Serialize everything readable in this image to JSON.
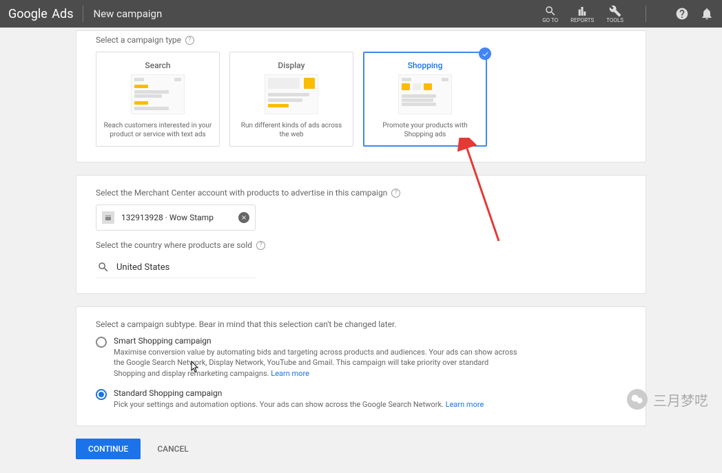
{
  "header": {
    "logo_prefix": "Google",
    "logo_suffix": "Ads",
    "page_title": "New campaign",
    "tools": [
      {
        "label": "GO TO"
      },
      {
        "label": "REPORTS"
      },
      {
        "label": "TOOLS"
      }
    ]
  },
  "campaign_type": {
    "label": "Select a campaign type",
    "options": [
      {
        "title": "Search",
        "desc": "Reach customers interested in your product or service with text ads"
      },
      {
        "title": "Display",
        "desc": "Run different kinds of ads across the web"
      },
      {
        "title": "Shopping",
        "desc": "Promote your products with Shopping ads"
      }
    ]
  },
  "merchant": {
    "label": "Select the Merchant Center account with products to advertise in this campaign",
    "value": "132913928 · Wow Stamp",
    "country_label": "Select the country where products are sold",
    "country_value": "United States"
  },
  "subtype": {
    "label": "Select a campaign subtype. Bear in mind that this selection can't be changed later.",
    "options": [
      {
        "title": "Smart Shopping campaign",
        "desc": "Maximise conversion value by automating bids and targeting across products and audiences. Your ads can show across the Google Search Network, Display Network, YouTube and Gmail. This campaign will take priority over standard Shopping and display remarketing campaigns.",
        "learn": "Learn more"
      },
      {
        "title": "Standard Shopping campaign",
        "desc": "Pick your settings and automation options. Your ads can show across the Google Search Network.",
        "learn": "Learn more"
      }
    ]
  },
  "buttons": {
    "continue": "CONTINUE",
    "cancel": "CANCEL"
  },
  "watermark": "三月梦呓"
}
